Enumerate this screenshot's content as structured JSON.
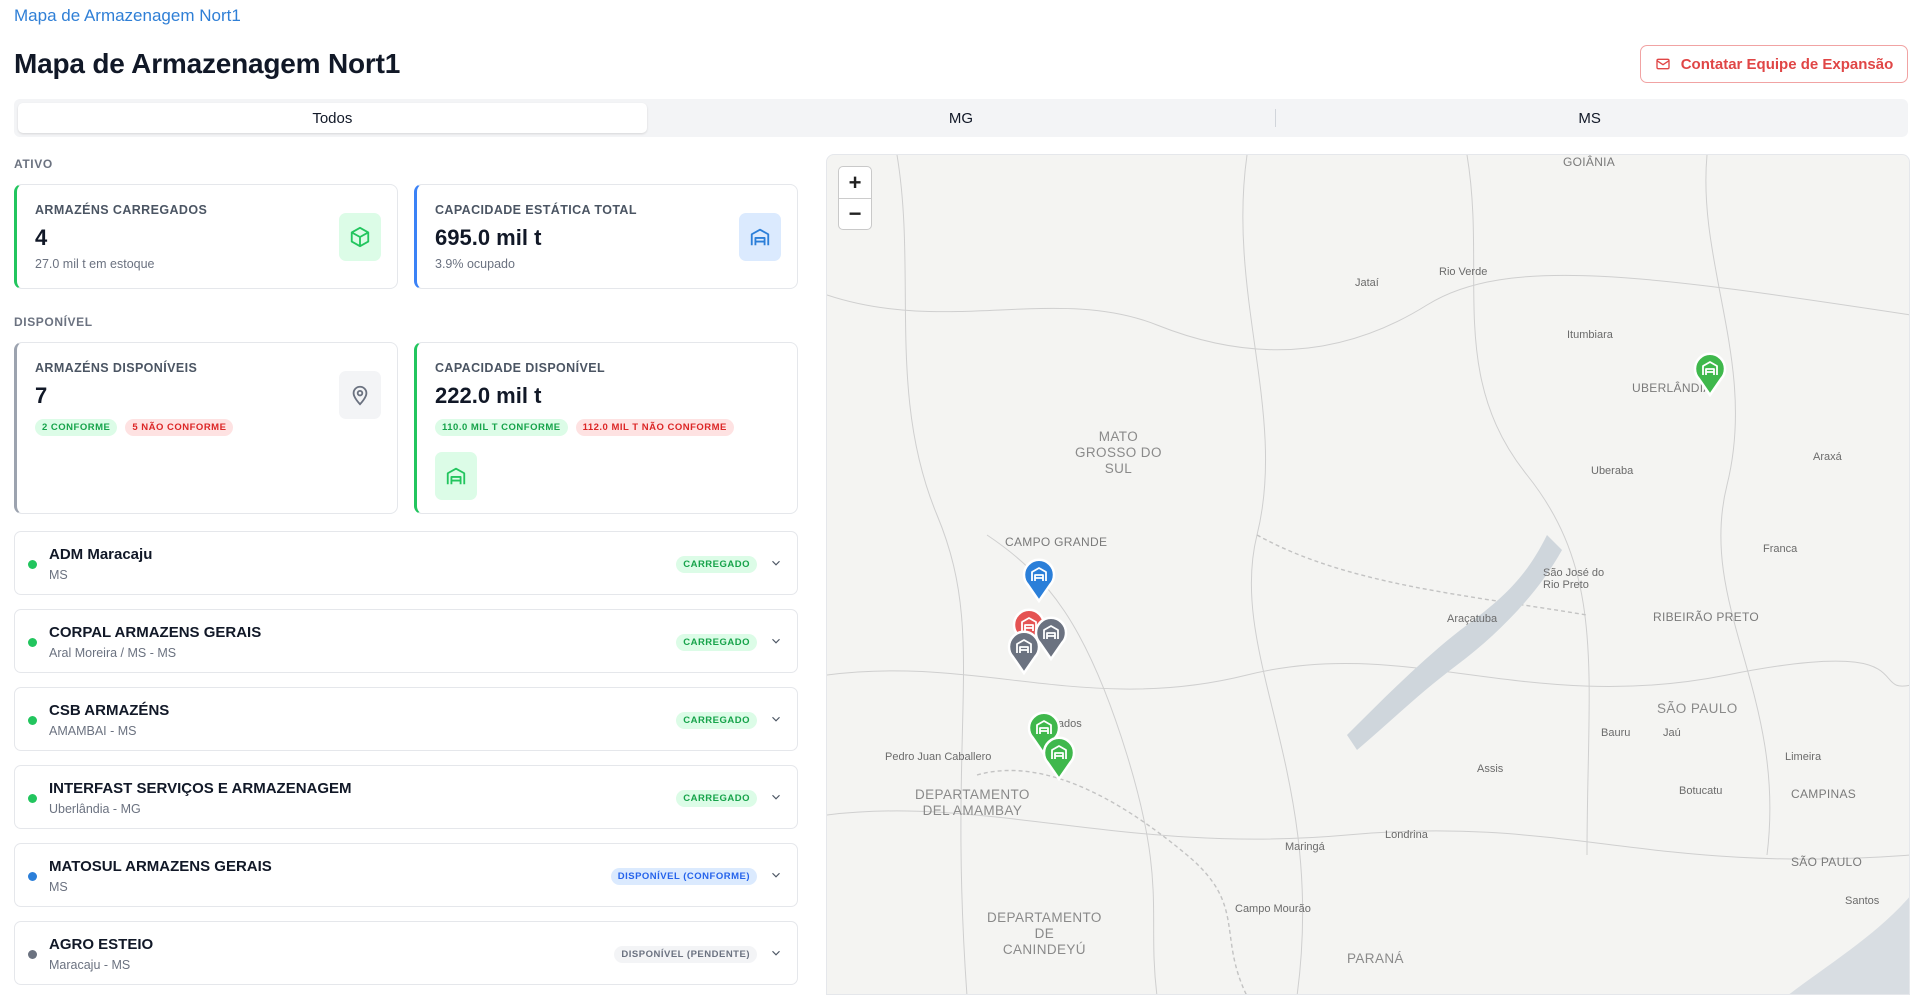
{
  "breadcrumb": "Mapa de Armazenagem Nort1",
  "page_title": "Mapa de Armazenagem Nort1",
  "contact_button": "Contatar Equipe de Expansão",
  "tabs": [
    {
      "label": "Todos",
      "active": true
    },
    {
      "label": "MG",
      "active": false
    },
    {
      "label": "MS",
      "active": false
    }
  ],
  "sections": {
    "ativo": "ATIVO",
    "disponivel": "DISPONÍVEL"
  },
  "cards": {
    "armazens_carregados": {
      "label": "ARMAZÉNS CARREGADOS",
      "value": "4",
      "sub": "27.0 mil t em estoque",
      "icon": "package-icon"
    },
    "capacidade_total": {
      "label": "CAPACIDADE ESTÁTICA TOTAL",
      "value": "695.0 mil t",
      "sub": "3.9% ocupado",
      "icon": "warehouse-icon"
    },
    "armazens_disponiveis": {
      "label": "ARMAZÉNS DISPONÍVEIS",
      "value": "7",
      "badge_ok": "2 CONFORME",
      "badge_bad": "5 NÃO CONFORME",
      "icon": "map-pin-icon"
    },
    "capacidade_disponivel": {
      "label": "CAPACIDADE DISPONÍVEL",
      "value": "222.0 mil t",
      "badge_ok": "110.0 MIL T CONFORME",
      "badge_bad": "112.0 MIL T NÃO CONFORME",
      "icon": "warehouse-icon"
    }
  },
  "warehouses": [
    {
      "name": "ADM Maracaju",
      "location": "MS",
      "status": "CARREGADO",
      "status_type": "ok",
      "dot_color": "#22c55e"
    },
    {
      "name": "CORPAL ARMAZENS GERAIS",
      "location": "Aral Moreira / MS - MS",
      "status": "CARREGADO",
      "status_type": "ok",
      "dot_color": "#22c55e"
    },
    {
      "name": "CSB ARMAZÉNS",
      "location": "AMAMBAI - MS",
      "status": "CARREGADO",
      "status_type": "ok",
      "dot_color": "#22c55e"
    },
    {
      "name": "INTERFAST SERVIÇOS E ARMAZENAGEM",
      "location": "Uberlândia - MG",
      "status": "CARREGADO",
      "status_type": "ok",
      "dot_color": "#22c55e"
    },
    {
      "name": "MATOSUL ARMAZENS GERAIS",
      "location": "MS",
      "status": "DISPONÍVEL (CONFORME)",
      "status_type": "info",
      "dot_color": "#2b7fd9"
    },
    {
      "name": "AGRO ESTEIO",
      "location": "Maracaju - MS",
      "status": "DISPONÍVEL (PENDENTE)",
      "status_type": "pend",
      "dot_color": "#6b7280"
    }
  ],
  "map": {
    "zoom_in": "+",
    "zoom_out": "−",
    "labels": {
      "goiania": "GOIÂNIA",
      "jatai": "Jataí",
      "rio_verde": "Rio Verde",
      "itumbiara": "Itumbiara",
      "uberlandia": "UBERLÂNDIA",
      "mato_grosso_do_sul": "MATO\nGROSSO DO\nSUL",
      "uberaba": "Uberaba",
      "araxa": "Araxá",
      "campo_grande": "CAMPO GRANDE",
      "franca": "Franca",
      "sao_jose_rio_preto": "São José do\nRio Preto",
      "aracatuba": "Araçatuba",
      "ribeirao_preto": "RIBEIRÃO PRETO",
      "dourados": "Dourados",
      "sao_paulo_state": "SÃO PAULO",
      "bauru": "Bauru",
      "jau": "Jaú",
      "pedro_juan": "Pedro Juan Caballero",
      "assis": "Assis",
      "limeira": "Limeira",
      "depto_amambay": "DEPARTAMENTO\nDEL AMAMBAY",
      "botucatu": "Botucatu",
      "campinas": "CAMPINAS",
      "londrina": "Londrina",
      "maringa": "Maringá",
      "sao_paulo_city": "SÃO PAULO",
      "santos": "Santos",
      "campo_mourao": "Campo Mourão",
      "depto_canindeyu": "DEPARTAMENTO\nDE\nCANINDEYÚ",
      "parana": "PARANÁ"
    },
    "marker_colors": {
      "green": "#3fb84c",
      "blue": "#2b7fd9",
      "red": "#e55353",
      "gray": "#6b7280"
    }
  }
}
